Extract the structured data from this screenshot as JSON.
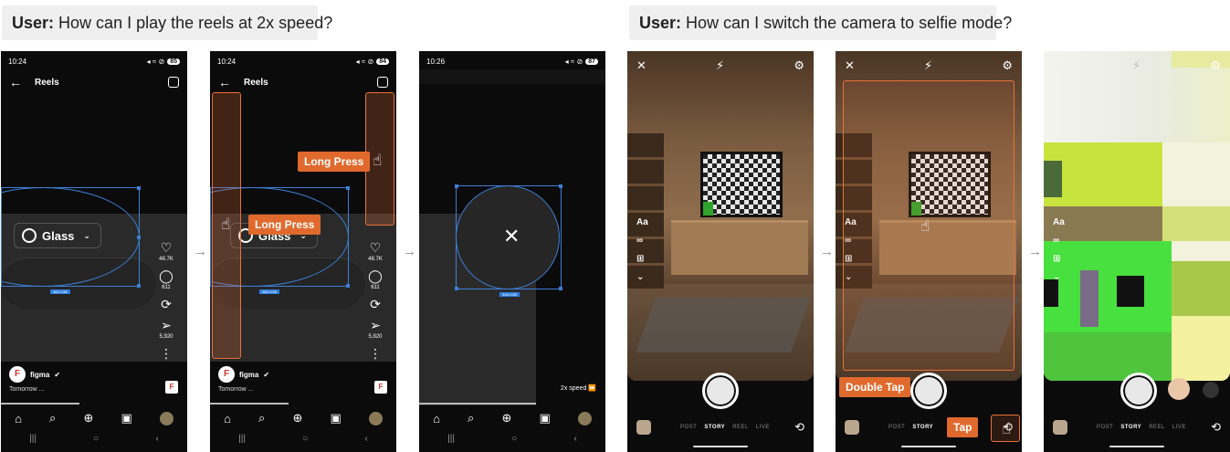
{
  "left_example": {
    "question_prefix": "User:",
    "question_text": "How can I play the reels at 2x speed?",
    "screens": [
      {
        "time": "10:24",
        "battery": "85",
        "title": "Reels",
        "pill_label": "Glass",
        "likes": "48.7K",
        "comments": "611",
        "shares": "5,920",
        "username": "figma",
        "caption": "Tomorrow ...",
        "dimension": "482×138"
      },
      {
        "time": "10:24",
        "battery": "84",
        "title": "Reels",
        "pill_label": "Glass",
        "likes": "48.7K",
        "comments": "611",
        "shares": "5,920",
        "username": "figma",
        "caption": "Tomorrow ...",
        "dimension": "482×138",
        "annotation_1": "Long Press",
        "annotation_2": "Long Press"
      },
      {
        "time": "10:26",
        "battery": "87",
        "speed_label": "2x speed ⏩",
        "dimension": "345×138"
      }
    ]
  },
  "right_example": {
    "question_prefix": "User:",
    "question_text": "How can I switch the camera to selfie mode?",
    "tools": [
      "Aa",
      "∞",
      "⊞",
      "⌄"
    ],
    "modes": [
      "POST",
      "STORY",
      "REEL",
      "LIVE"
    ],
    "annotation_double_tap": "Double Tap",
    "annotation_tap": "Tap"
  },
  "icons": {
    "close": "✕",
    "flash_off": "⚡",
    "settings": "⚙",
    "back": "←",
    "heart": "♡",
    "comment": "◯",
    "repost": "⟳",
    "send": "➢",
    "more": "⋮",
    "home": "⌂",
    "search": "⌕",
    "add": "⊕",
    "reels": "▣",
    "flip": "⟲",
    "hand": "☝"
  },
  "accent_color": "#e06a2d"
}
